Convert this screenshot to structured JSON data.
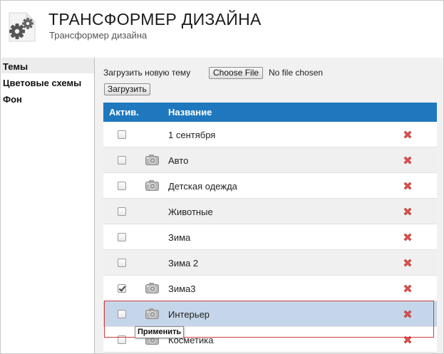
{
  "header": {
    "title": "ТРАНСФОРМЕР ДИЗАЙНА",
    "subtitle": "Трансформер дизайна",
    "logo_icon": "gears-icon"
  },
  "sidebar": {
    "items": [
      {
        "label": "Темы",
        "active": true
      },
      {
        "label": "Цветовые схемы",
        "active": false
      },
      {
        "label": "Фон",
        "active": false
      }
    ]
  },
  "upload": {
    "label": "Загрузить новую тему",
    "choose_button": "Choose File",
    "file_status": "No file chosen",
    "submit_button": "Загрузить"
  },
  "table": {
    "columns": [
      "Актив.",
      "Название"
    ],
    "rows": [
      {
        "name": "1 сентября",
        "active": false,
        "has_screenshot": false
      },
      {
        "name": "Авто",
        "active": false,
        "has_screenshot": true
      },
      {
        "name": "Детская одежда",
        "active": false,
        "has_screenshot": true
      },
      {
        "name": "Животные",
        "active": false,
        "has_screenshot": false
      },
      {
        "name": "Зима",
        "active": false,
        "has_screenshot": false
      },
      {
        "name": "Зима 2",
        "active": false,
        "has_screenshot": false
      },
      {
        "name": "Зима3",
        "active": true,
        "has_screenshot": true
      },
      {
        "name": "Интерьер",
        "active": false,
        "has_screenshot": true,
        "hovered": true
      },
      {
        "name": "Косметика",
        "active": false,
        "has_screenshot": true
      }
    ]
  },
  "tooltip": {
    "text": "Применить"
  },
  "colors": {
    "table_header": "#1f78bd",
    "hover_row": "#c6d6ea",
    "delete_icon": "#d9534f",
    "highlight_border": "#d23b3b"
  }
}
